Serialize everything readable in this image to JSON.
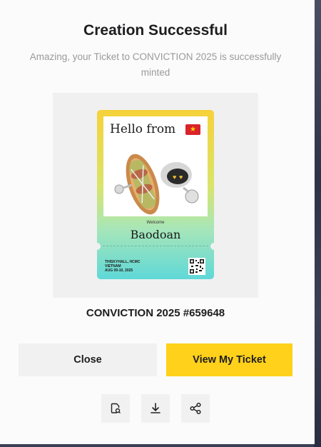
{
  "modal": {
    "title": "Creation Successful",
    "subtitle": "Amazing, your Ticket to CONVICTION 2025 is successfully minted",
    "ticket_title": "CONVICTION 2025 #659648"
  },
  "ticket": {
    "greeting": "Hello from",
    "flag": "flag-vietnam-icon",
    "welcome": "Welcome",
    "name": "Baodoan",
    "venue_lines": [
      "THISKYHALL, HCMC",
      "VIETNAM",
      "AUG 09-10, 2025"
    ],
    "qr": "qr-code-icon",
    "colors": {
      "top": "#f6d23a",
      "bottom": "#5fd8d8"
    }
  },
  "actions": {
    "close_label": "Close",
    "view_label": "View My Ticket"
  },
  "icon_actions": [
    {
      "icon": "document-search-icon"
    },
    {
      "icon": "download-icon"
    },
    {
      "icon": "share-icon"
    }
  ],
  "colors": {
    "accent": "#ffd11a",
    "secondary_button": "#f1f1f1",
    "muted_text": "#9a9a9a"
  }
}
